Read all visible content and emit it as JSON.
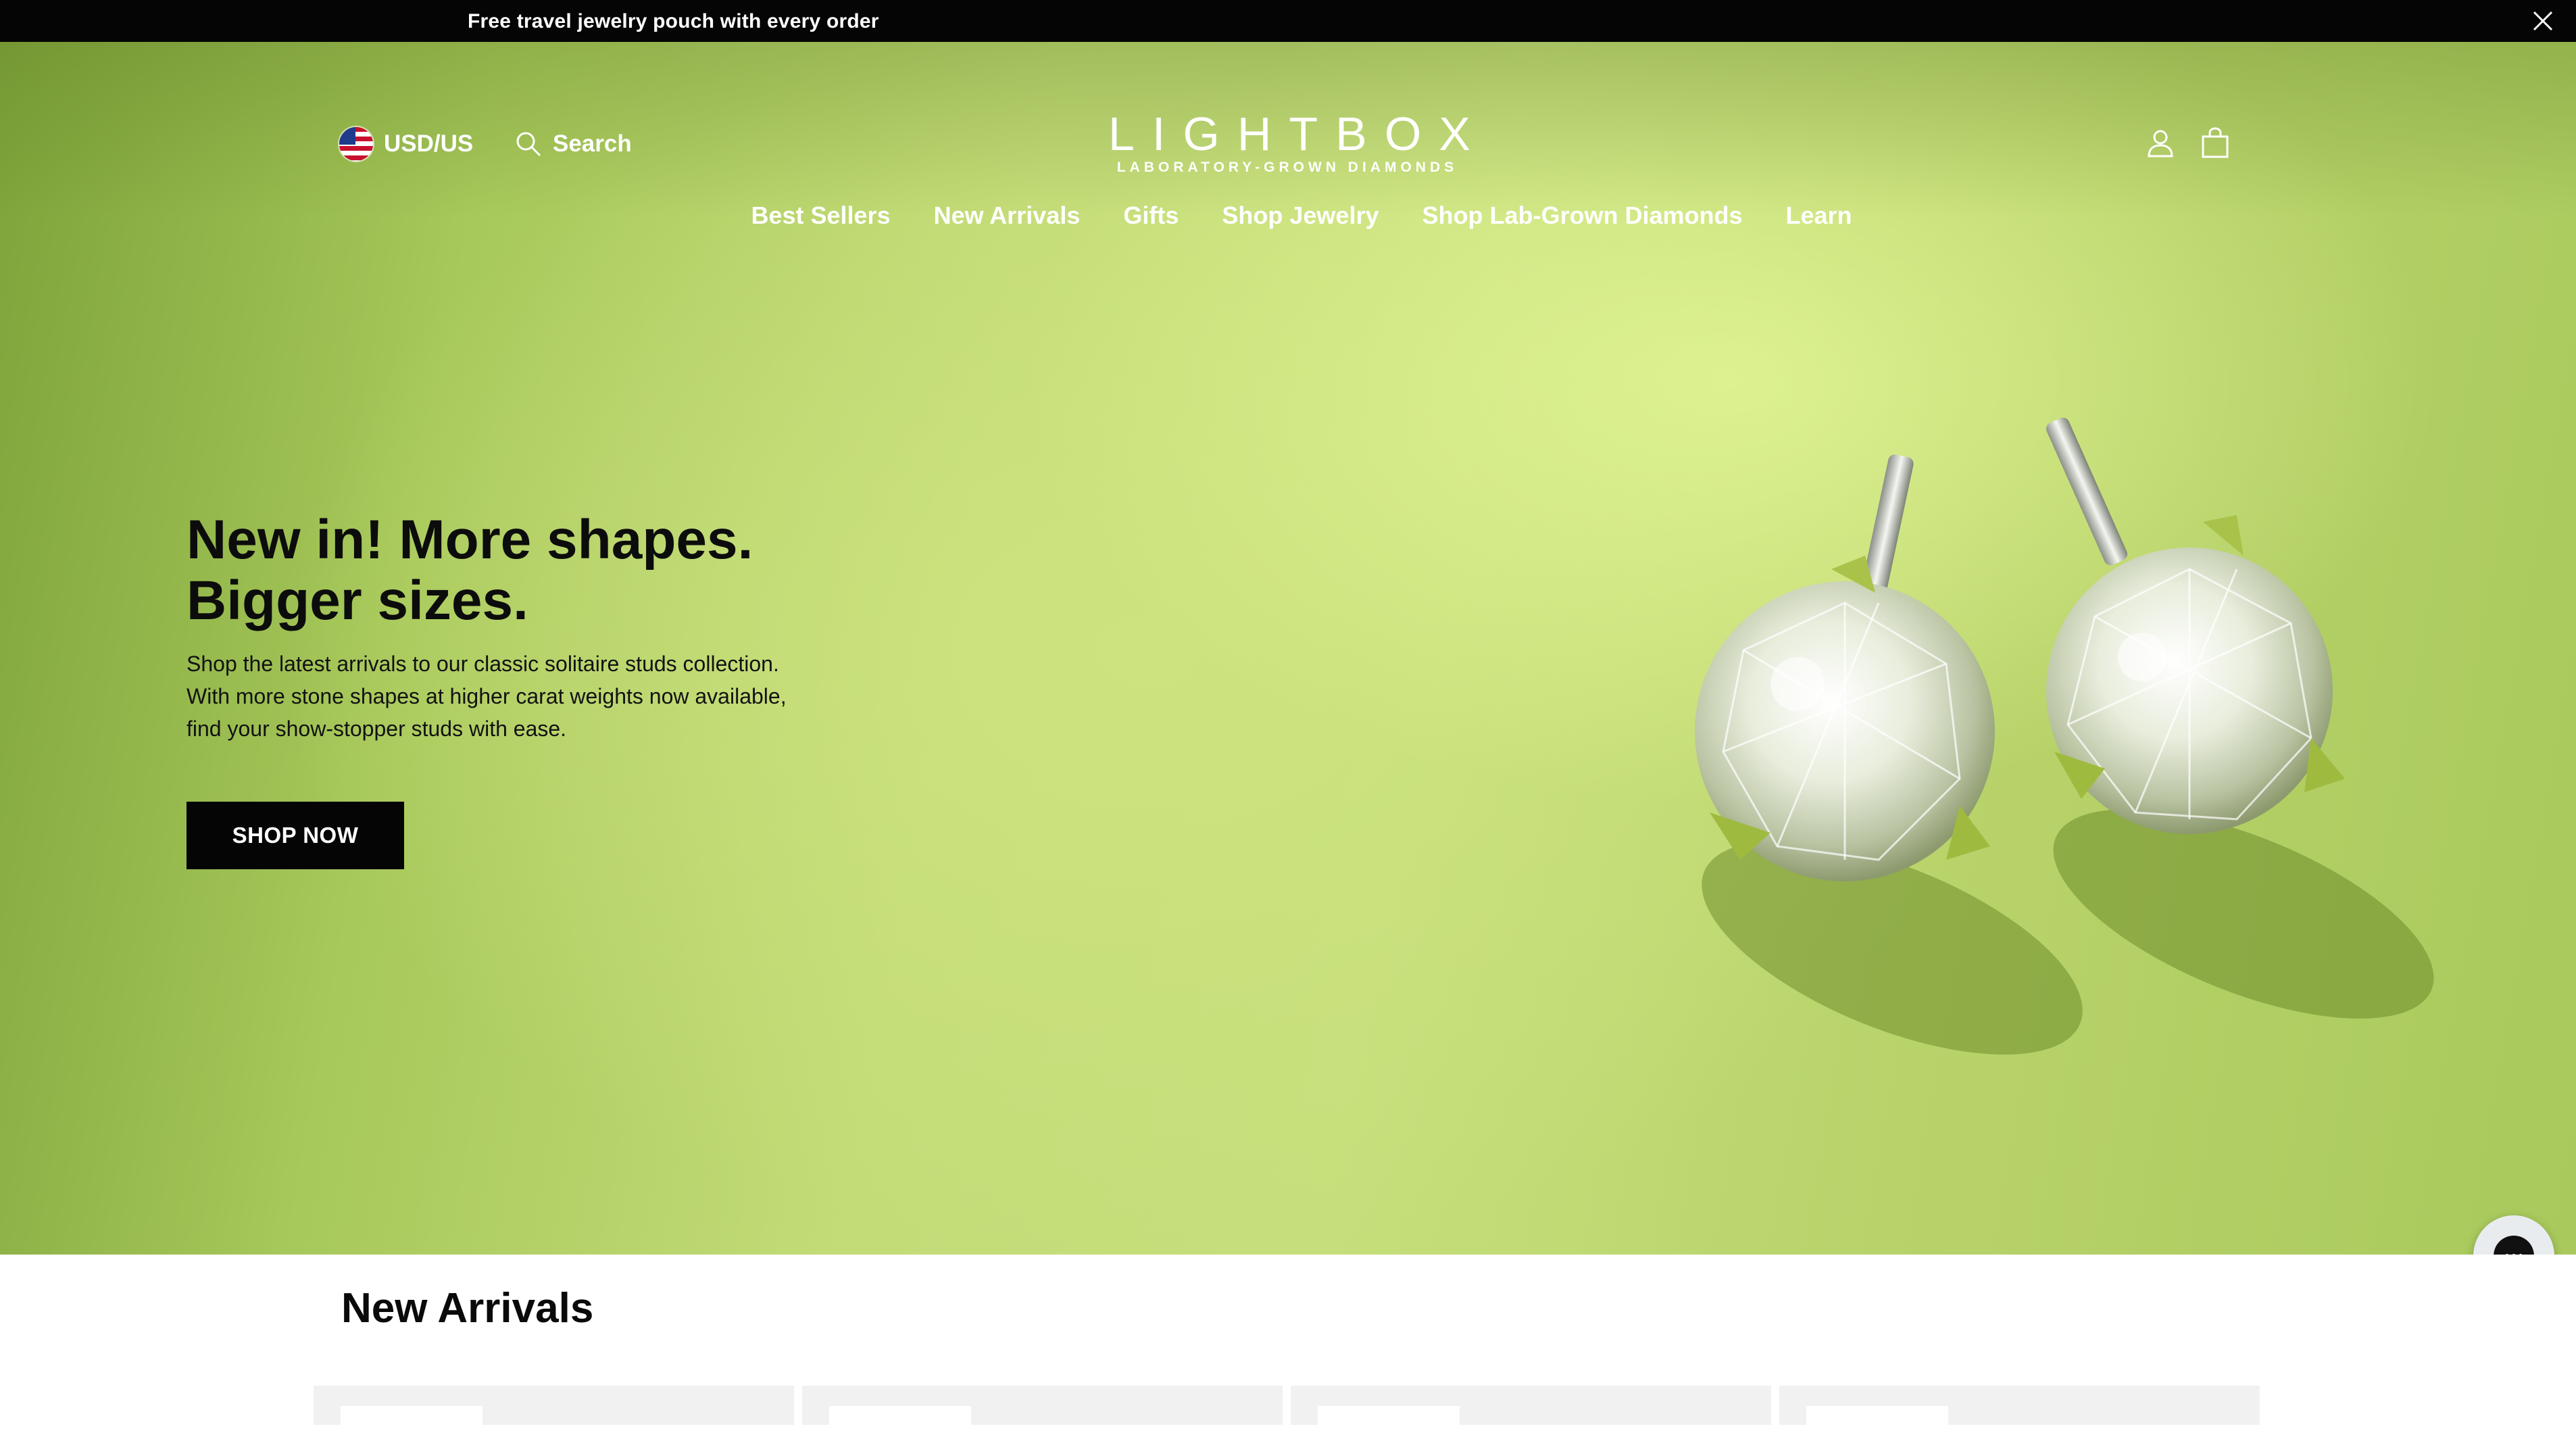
{
  "announcement": {
    "text": "Free travel jewelry pouch with every order"
  },
  "header": {
    "currency_label": "USD/US",
    "search_label": "Search",
    "logo_name": "LIGHTBOX",
    "logo_tagline": "LABORATORY-GROWN DIAMONDS"
  },
  "nav": {
    "items": [
      {
        "label": "Best Sellers"
      },
      {
        "label": "New Arrivals"
      },
      {
        "label": "Gifts"
      },
      {
        "label": "Shop Jewelry"
      },
      {
        "label": "Shop Lab-Grown Diamonds"
      },
      {
        "label": "Learn"
      }
    ]
  },
  "hero": {
    "heading_line1": "New in! More shapes.",
    "heading_line2": "Bigger sizes.",
    "body": "Shop the latest arrivals to our classic solitaire studs collection. With more stone shapes at higher carat weights now available, find your show-stopper studs with ease.",
    "cta_label": "SHOP NOW",
    "background_color": "#c3dc78",
    "image": "diamond-stud-earrings"
  },
  "section": {
    "title": "New Arrivals"
  },
  "icons": [
    "close-icon",
    "us-flag-icon",
    "search-icon",
    "account-icon",
    "shopping-bag-icon",
    "chat-icon"
  ]
}
